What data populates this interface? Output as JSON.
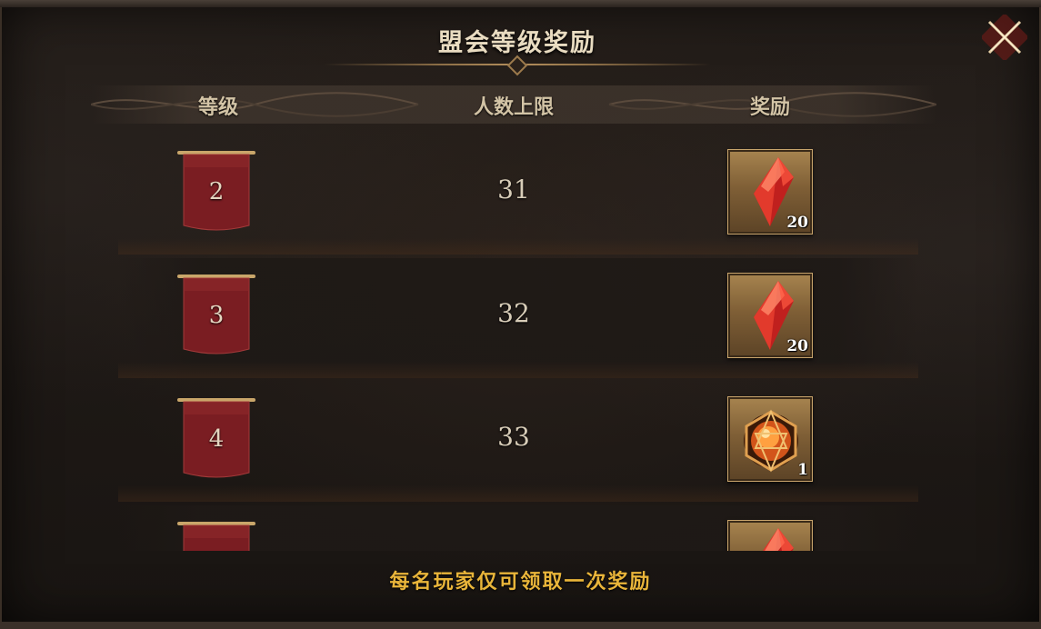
{
  "window": {
    "title": "盟会等级奖励"
  },
  "table": {
    "headers": {
      "level": "等级",
      "limit": "人数上限",
      "reward": "奖励"
    },
    "rows": [
      {
        "level": "2",
        "limit": "31",
        "reward_item": "red-crystal",
        "reward_count": "20"
      },
      {
        "level": "3",
        "limit": "32",
        "reward_item": "red-crystal",
        "reward_count": "20"
      },
      {
        "level": "4",
        "limit": "33",
        "reward_item": "orange-gem-orb",
        "reward_count": "1"
      },
      {
        "level": "",
        "limit": "",
        "reward_item": "red-crystal",
        "reward_count": ""
      }
    ]
  },
  "footer": {
    "note": "每名玩家仅可领取一次奖励"
  },
  "colors": {
    "accent_gold": "#e9b53a",
    "banner_red": "#7a1d22",
    "reward_frame": "#a7844f"
  },
  "icons": {
    "close": "close-x-icon"
  }
}
